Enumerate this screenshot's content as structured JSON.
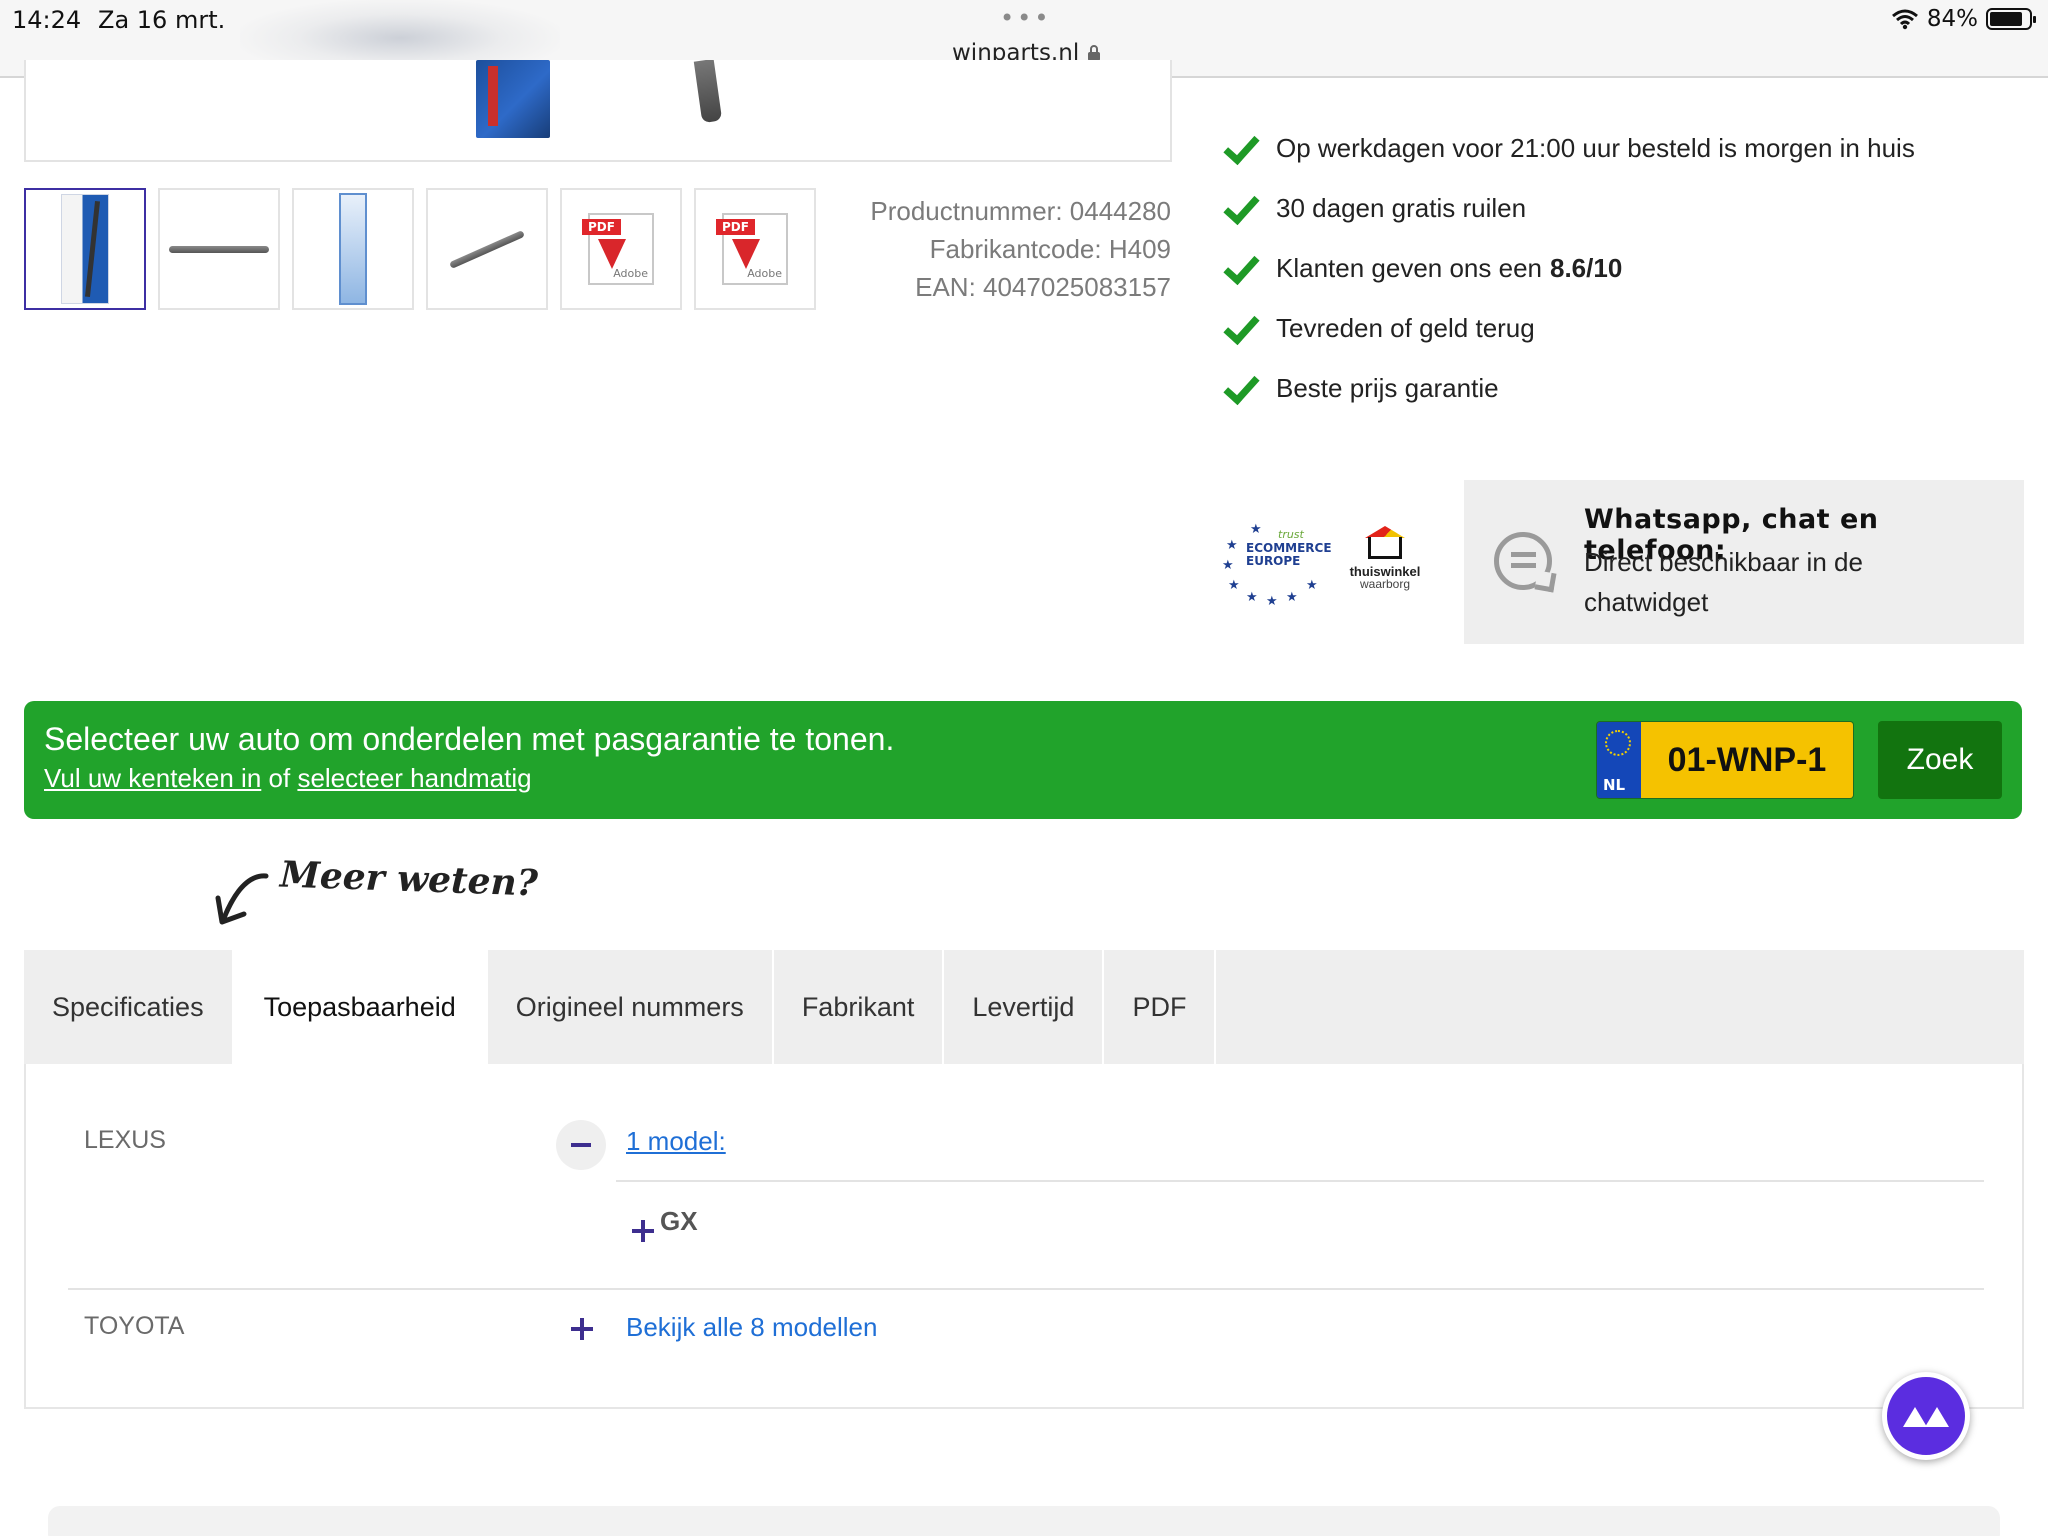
{
  "status_bar": {
    "time": "14:24",
    "date": "Za 16 mrt.",
    "url": "winparts.nl",
    "battery": "84%",
    "battery_level": 0.84
  },
  "gallery": {
    "thumbnails": [
      {
        "kind": "package",
        "active": true
      },
      {
        "kind": "blade-horizontal"
      },
      {
        "kind": "box"
      },
      {
        "kind": "blade-diagonal"
      },
      {
        "kind": "pdf",
        "tag": "PDF",
        "brand": "Adobe"
      },
      {
        "kind": "pdf",
        "tag": "PDF",
        "brand": "Adobe"
      }
    ]
  },
  "product_meta": {
    "product_number": "Productnummer: 0444280",
    "manufacturer_code": "Fabrikantcode: H409",
    "ean": "EAN: 4047025083157"
  },
  "usps": [
    {
      "text": "Op werkdagen voor 21:00 uur besteld is morgen in huis",
      "bold": ""
    },
    {
      "text": "30 dagen gratis ruilen",
      "bold": ""
    },
    {
      "text": "Klanten geven ons een",
      "bold": "8.6/10"
    },
    {
      "text": "Tevreden of geld terug",
      "bold": ""
    },
    {
      "text": "Beste prijs garantie",
      "bold": ""
    }
  ],
  "badges": {
    "ecommerce_trust": "trust",
    "ecommerce_line1": "ECOMMERCE",
    "ecommerce_line2": "EUROPE",
    "thuiswinkel_line1": "thuiswinkel",
    "thuiswinkel_line2": "waarborg"
  },
  "chat": {
    "title": "Whatsapp, chat en telefoon:",
    "text": "Direct beschikbaar in de chatwidget"
  },
  "vehicle_selector": {
    "title": "Selecteer uw auto om onderdelen met pasgarantie te tonen.",
    "link_plate": "Vul uw kenteken in",
    "connector": "of",
    "link_manual": "selecteer handmatig",
    "plate_country": "NL",
    "plate_value": "01-WNP-1",
    "search_button": "Zoek"
  },
  "meer_weten": "Meer weten?",
  "tabs": [
    {
      "label": "Specificaties",
      "active": false
    },
    {
      "label": "Toepasbaarheid",
      "active": true
    },
    {
      "label": "Origineel nummers",
      "active": false
    },
    {
      "label": "Fabrikant",
      "active": false
    },
    {
      "label": "Levertijd",
      "active": false
    },
    {
      "label": "PDF",
      "active": false
    }
  ],
  "applicability": {
    "brands": [
      {
        "name": "LEXUS",
        "link": "1 model:",
        "expanded": true,
        "models": [
          "GX"
        ]
      },
      {
        "name": "TOYOTA",
        "link": "Bekijk alle 8 modellen",
        "expanded": false,
        "models": []
      }
    ]
  },
  "colors": {
    "green_bar": "#21a32b",
    "check_green": "#1e9a26",
    "plate_yellow": "#f5c200",
    "zoek_button": "#12740f",
    "link_blue": "#1f6fd6",
    "accent_purple": "#3d2e8f",
    "fab_purple": "#5b2de0"
  }
}
